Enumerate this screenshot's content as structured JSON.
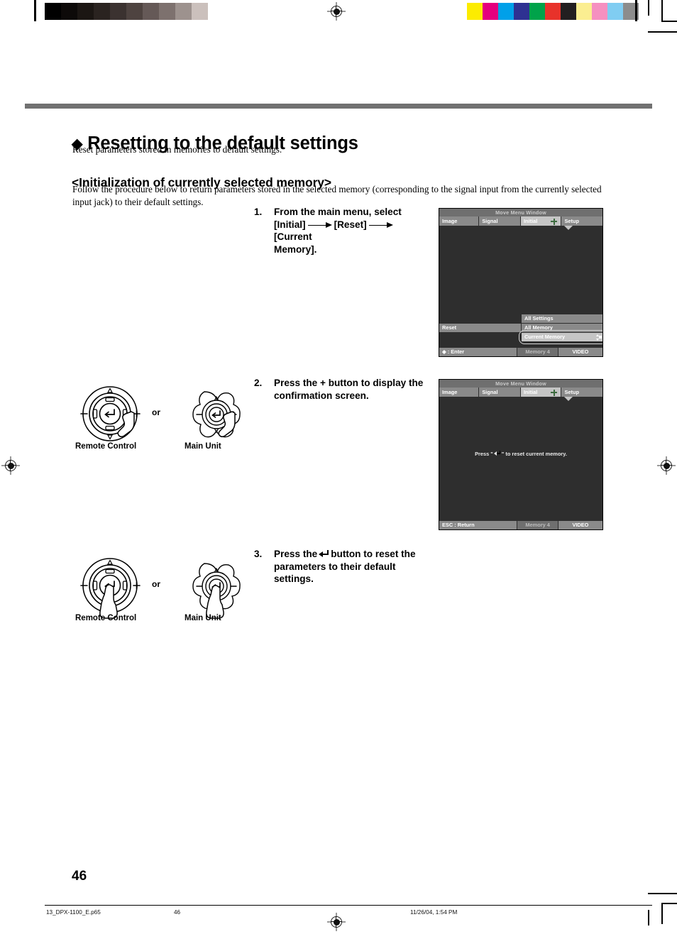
{
  "page": {
    "heading": "Resetting to the default settings",
    "heading_bullet": "◆",
    "lead": "Reset parameters stored in memories to default settings.",
    "subheading": "<Initialization of currently selected memory>",
    "intro": "Follow the procedure below to return parameters stored in the selected memory (corresponding to the signal input from the currently selected input jack) to their default settings.",
    "page_number": "46"
  },
  "steps": [
    {
      "number": "1.",
      "text_part1": "From the main menu, select",
      "text_part2": "[Initial]",
      "text_part3": "[Reset]",
      "text_part4": "[Current",
      "text_part5": "Memory]."
    },
    {
      "number": "2.",
      "text_part1": "Press the + button to display the",
      "text_part2": "confirmation screen."
    },
    {
      "number": "3.",
      "text_part1": "Press the",
      "text_part2": "button to reset the",
      "text_part3": "parameters to their default",
      "text_part4": "settings."
    }
  ],
  "controls": [
    {
      "remote_caption": "Remote Control",
      "main_caption": "Main Unit",
      "or_label": "or",
      "plus_label": "+",
      "minus_label": "−"
    },
    {
      "remote_caption": "Remote Control",
      "main_caption": "Main Unit",
      "or_label": "or",
      "plus_label": "+",
      "minus_label": "−"
    }
  ],
  "osd_screens": [
    {
      "title": "Move Menu Window",
      "tabs": [
        "Image",
        "Signal",
        "Initial",
        "Setup"
      ],
      "selected_tab": "Initial",
      "row_label": "Reset",
      "menu_items": [
        "All Settings",
        "All Memory",
        "Current Memory"
      ],
      "highlighted_item": "Current Memory",
      "bottom_left": "◈ : Enter",
      "bottom_center": "Memory 4",
      "bottom_right": "VIDEO"
    },
    {
      "title": "Move Menu Window",
      "tabs": [
        "Image",
        "Signal",
        "Initial",
        "Setup"
      ],
      "selected_tab": "Initial",
      "message_pre": "Press \"",
      "message_post": "\" to reset current memory.",
      "bottom_left": "ESC : Return",
      "bottom_center": "Memory 4",
      "bottom_right": "VIDEO"
    }
  ],
  "footer": {
    "filename": "13_DPX-1100_E.p65",
    "page": "46",
    "timestamp": "11/26/04, 1:54 PM"
  },
  "calibration": {
    "gray_swatches": [
      "#000000",
      "#0d0a09",
      "#1b1613",
      "#2a2320",
      "#3b3230",
      "#4e4340",
      "#655957",
      "#7d716e",
      "#9d928e",
      "#cbc0bc",
      "#ffffff"
    ],
    "color_swatches": [
      "#fcec00",
      "#e5007e",
      "#00a0e9",
      "#2e3192",
      "#00a34a",
      "#e8322a",
      "#231f20",
      "#fbee91",
      "#f590c0",
      "#80cdf2",
      "#8c8c8c"
    ]
  }
}
